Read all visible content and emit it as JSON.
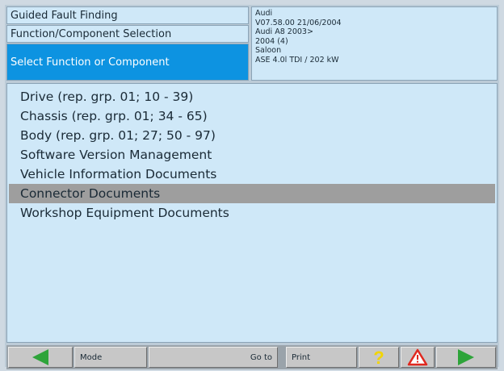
{
  "header": {
    "title": "Guided Fault Finding",
    "subtitle": "Function/Component Selection",
    "prompt": "Select Function or Component"
  },
  "vehicle_info": {
    "make": "Audi",
    "version": "V07.58.00 21/06/2004",
    "model": "Audi A8 2003>",
    "year": "2004 (4)",
    "body": "Saloon",
    "engine": "ASE 4.0l TDI / 202 kW"
  },
  "list": {
    "items": [
      {
        "label": "Drive (rep. grp. 01; 10 - 39)",
        "selected": false
      },
      {
        "label": "Chassis (rep. grp. 01; 34 - 65)",
        "selected": false
      },
      {
        "label": "Body (rep. grp. 01; 27; 50 - 97)",
        "selected": false
      },
      {
        "label": "Software Version Management",
        "selected": false
      },
      {
        "label": "Vehicle Information Documents",
        "selected": false
      },
      {
        "label": "Connector Documents",
        "selected": true
      },
      {
        "label": "Workshop Equipment Documents",
        "selected": false
      }
    ]
  },
  "toolbar": {
    "mode_label": "Mode",
    "goto_label": "Go to",
    "print_label": "Print",
    "back_icon": "left-arrow-icon",
    "forward_icon": "right-arrow-icon",
    "help_icon": "question-icon",
    "warning_icon": "warning-icon",
    "arrow_color": "#2ea43a",
    "help_color": "#f2d500",
    "warning_color": "#e0281f"
  },
  "colors": {
    "selected_header": "#0d93e1",
    "panel": "#cfe8f8",
    "selected_row": "#9e9e9e"
  }
}
